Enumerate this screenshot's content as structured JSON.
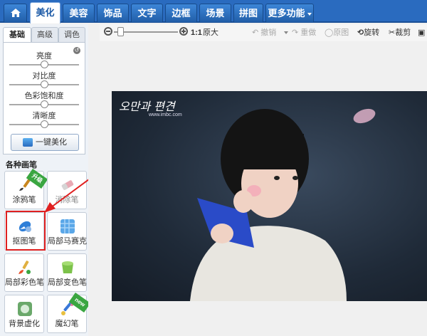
{
  "nav": {
    "items": [
      {
        "label": "美化",
        "active": true
      },
      {
        "label": "美容",
        "active": false
      },
      {
        "label": "饰品",
        "active": false
      },
      {
        "label": "文字",
        "active": false
      },
      {
        "label": "边框",
        "active": false
      },
      {
        "label": "场景",
        "active": false
      },
      {
        "label": "拼图",
        "active": false
      },
      {
        "label": "更多功能",
        "active": false
      }
    ]
  },
  "toolbar": {
    "ratio_label": "1:1",
    "original_label": "原大",
    "undo_label": "撤销",
    "redo_label": "重做",
    "original_image_label": "原图",
    "rotate_label": "旋转",
    "crop_label": "裁剪",
    "zoom_value": 0.1
  },
  "tabs": [
    "基础",
    "高级",
    "调色"
  ],
  "adjust": {
    "brightness_label": "亮度",
    "contrast_label": "对比度",
    "saturation_label": "色彩饱和度",
    "sharpness_label": "清晰度",
    "levels": [
      0.5,
      0.5,
      0.5,
      0.5
    ],
    "oneclick_label": "一键美化"
  },
  "brushes": {
    "section_title": "各种画笔",
    "items": [
      {
        "label": "涂鸦笔",
        "badge": "升级"
      },
      {
        "label": "消除笔",
        "badge": ""
      },
      {
        "label": "抠图笔",
        "badge": ""
      },
      {
        "label": "局部马赛克",
        "badge": ""
      },
      {
        "label": "局部彩色笔",
        "badge": ""
      },
      {
        "label": "局部变色笔",
        "badge": ""
      },
      {
        "label": "背景虚化",
        "badge": ""
      },
      {
        "label": "魔幻笔",
        "badge": "new"
      }
    ]
  },
  "photo": {
    "logo_text": "오만과 편견",
    "logo_sub": "www.imbc.com"
  },
  "colors": {
    "nav_bg": "#2a6bbf",
    "highlight": "#e02020"
  }
}
